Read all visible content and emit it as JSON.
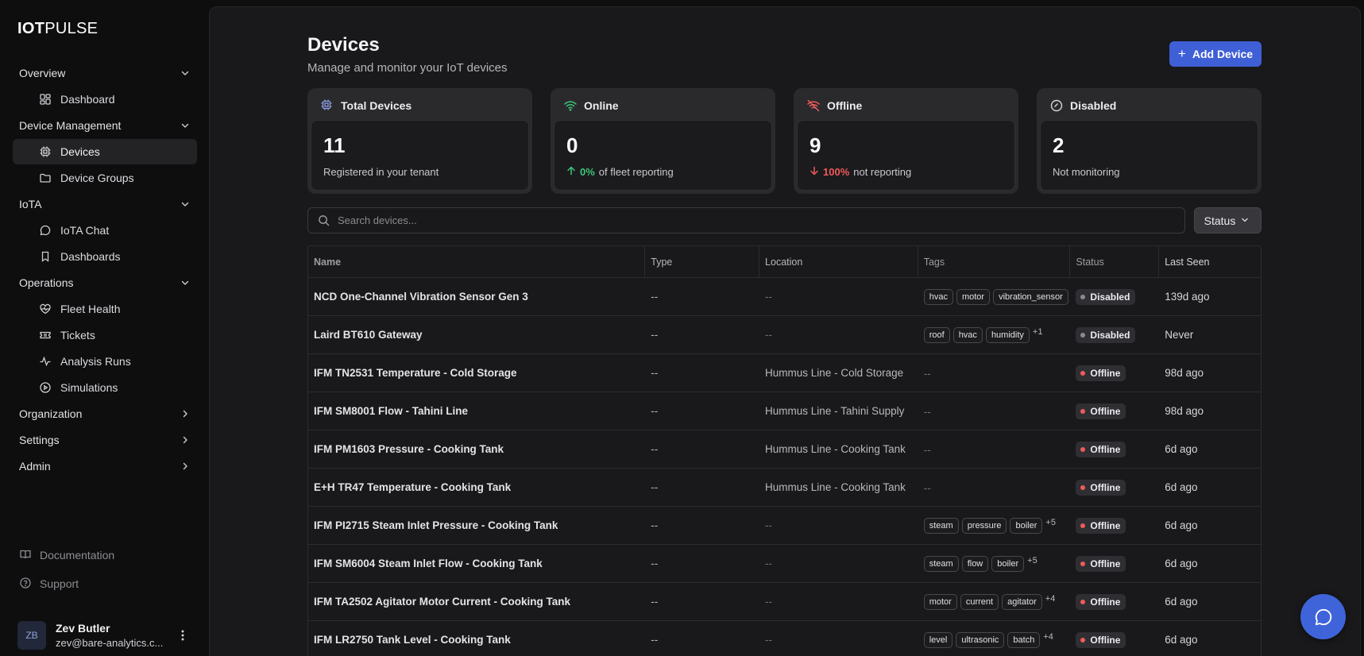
{
  "app": {
    "logo_bold": "IOT",
    "logo_light": "PULSE"
  },
  "sidebar": {
    "sections": [
      {
        "label": "Overview",
        "expanded": true,
        "items": [
          {
            "label": "Dashboard",
            "icon": "dashboard-icon"
          }
        ]
      },
      {
        "label": "Device Management",
        "expanded": true,
        "items": [
          {
            "label": "Devices",
            "icon": "chip-icon",
            "active": true
          },
          {
            "label": "Device Groups",
            "icon": "folder-icon"
          }
        ]
      },
      {
        "label": "IoTA",
        "expanded": true,
        "items": [
          {
            "label": "IoTA Chat",
            "icon": "chat-icon"
          },
          {
            "label": "Dashboards",
            "icon": "bookmark-icon"
          }
        ]
      },
      {
        "label": "Operations",
        "expanded": true,
        "items": [
          {
            "label": "Fleet Health",
            "icon": "heart-pulse-icon"
          },
          {
            "label": "Tickets",
            "icon": "ticket-icon"
          },
          {
            "label": "Analysis Runs",
            "icon": "activity-icon"
          },
          {
            "label": "Simulations",
            "icon": "play-circle-icon"
          }
        ]
      },
      {
        "label": "Organization",
        "expanded": false,
        "items": []
      },
      {
        "label": "Settings",
        "expanded": false,
        "items": []
      },
      {
        "label": "Admin",
        "expanded": false,
        "items": []
      }
    ],
    "footer": [
      {
        "label": "Documentation",
        "icon": "book-icon"
      },
      {
        "label": "Support",
        "icon": "help-circle-icon"
      }
    ],
    "user": {
      "initials": "ZB",
      "name": "Zev Butler",
      "email": "zev@bare-analytics.c..."
    }
  },
  "header": {
    "title": "Devices",
    "subtitle": "Manage and monitor your IoT devices",
    "add_button": "Add Device"
  },
  "stats": [
    {
      "label": "Total Devices",
      "value": "11",
      "desc": "Registered in your tenant",
      "icon": "chip-icon"
    },
    {
      "label": "Online",
      "value": "0",
      "pct": "0%",
      "desc": "of fleet reporting",
      "trend": "up",
      "icon": "wifi-icon"
    },
    {
      "label": "Offline",
      "value": "9",
      "pct": "100%",
      "desc": "not reporting",
      "trend": "down",
      "icon": "wifi-off-icon"
    },
    {
      "label": "Disabled",
      "value": "2",
      "desc": "Not monitoring",
      "icon": "check-circle-icon"
    }
  ],
  "search": {
    "placeholder": "Search devices..."
  },
  "filter": {
    "status_label": "Status"
  },
  "table": {
    "columns": [
      "Name",
      "Type",
      "Location",
      "Tags",
      "Status",
      "Last Seen"
    ],
    "rows": [
      {
        "name": "NCD One-Channel Vibration Sensor Gen 3",
        "type": "--",
        "location": "--",
        "tags": [
          "hvac",
          "motor",
          "vibration_sensor"
        ],
        "more": "",
        "status": "Disabled",
        "last_seen": "139d ago"
      },
      {
        "name": "Laird BT610 Gateway",
        "type": "--",
        "location": "--",
        "tags": [
          "roof",
          "hvac",
          "humidity"
        ],
        "more": "+1",
        "status": "Disabled",
        "last_seen": "Never"
      },
      {
        "name": "IFM TN2531 Temperature - Cold Storage",
        "type": "--",
        "location": "Hummus Line - Cold Storage",
        "tags": [],
        "more": "",
        "status": "Offline",
        "last_seen": "98d ago"
      },
      {
        "name": "IFM SM8001 Flow - Tahini Line",
        "type": "--",
        "location": "Hummus Line - Tahini Supply",
        "tags": [],
        "more": "",
        "status": "Offline",
        "last_seen": "98d ago"
      },
      {
        "name": "IFM PM1603 Pressure - Cooking Tank",
        "type": "--",
        "location": "Hummus Line - Cooking Tank",
        "tags": [],
        "more": "",
        "status": "Offline",
        "last_seen": "6d ago"
      },
      {
        "name": "E+H TR47 Temperature - Cooking Tank",
        "type": "--",
        "location": "Hummus Line - Cooking Tank",
        "tags": [],
        "more": "",
        "status": "Offline",
        "last_seen": "6d ago"
      },
      {
        "name": "IFM PI2715 Steam Inlet Pressure - Cooking Tank",
        "type": "--",
        "location": "--",
        "tags": [
          "steam",
          "pressure",
          "boiler"
        ],
        "more": "+5",
        "status": "Offline",
        "last_seen": "6d ago"
      },
      {
        "name": "IFM SM6004 Steam Inlet Flow - Cooking Tank",
        "type": "--",
        "location": "--",
        "tags": [
          "steam",
          "flow",
          "boiler"
        ],
        "more": "+5",
        "status": "Offline",
        "last_seen": "6d ago"
      },
      {
        "name": "IFM TA2502 Agitator Motor Current - Cooking Tank",
        "type": "--",
        "location": "--",
        "tags": [
          "motor",
          "current",
          "agitator"
        ],
        "more": "+4",
        "status": "Offline",
        "last_seen": "6d ago"
      },
      {
        "name": "IFM LR2750 Tank Level - Cooking Tank",
        "type": "--",
        "location": "--",
        "tags": [
          "level",
          "ultrasonic",
          "batch"
        ],
        "more": "+4",
        "status": "Offline",
        "last_seen": "6d ago"
      }
    ],
    "empty_tags": "--"
  },
  "colors": {
    "accent": "#3f5fd6",
    "online": "#3fc67a",
    "offline": "#ef5b5b",
    "disabled": "#8a8a90"
  }
}
